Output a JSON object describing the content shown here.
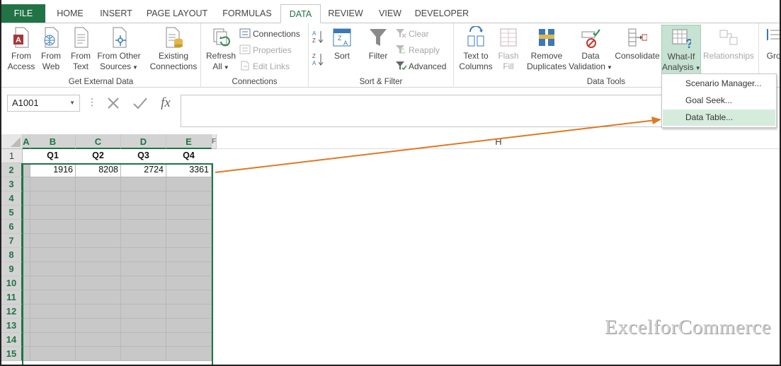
{
  "tabs": [
    "FILE",
    "HOME",
    "INSERT",
    "PAGE LAYOUT",
    "FORMULAS",
    "DATA",
    "REVIEW",
    "VIEW",
    "DEVELOPER"
  ],
  "active_tab": "DATA",
  "ribbon": {
    "get_external_data": {
      "label": "Get External Data",
      "from_access": [
        "From",
        "Access"
      ],
      "from_web": [
        "From",
        "Web"
      ],
      "from_text": [
        "From",
        "Text"
      ],
      "from_other": [
        "From Other",
        "Sources"
      ],
      "existing": [
        "Existing",
        "Connections"
      ]
    },
    "connections": {
      "label": "Connections",
      "refresh": [
        "Refresh",
        "All"
      ],
      "connections": "Connections",
      "properties": "Properties",
      "edit_links": "Edit Links"
    },
    "sort_filter": {
      "label": "Sort & Filter",
      "sort": "Sort",
      "filter": "Filter",
      "clear": "Clear",
      "reapply": "Reapply",
      "advanced": "Advanced"
    },
    "data_tools": {
      "label": "Data Tools",
      "text_to_columns": [
        "Text to",
        "Columns"
      ],
      "flash_fill": [
        "Flash",
        "Fill"
      ],
      "remove_duplicates": [
        "Remove",
        "Duplicates"
      ],
      "data_validation": [
        "Data",
        "Validation"
      ],
      "consolidate": "Consolidate",
      "what_if": [
        "What-If",
        "Analysis"
      ],
      "relationships": "Relationships"
    },
    "outline": {
      "group": "Grou"
    }
  },
  "whatif_menu": [
    "Scenario Manager...",
    "Goal Seek...",
    "Data Table..."
  ],
  "formula_bar": {
    "name_box": "A1001",
    "fx": "fx",
    "value": ""
  },
  "columns": [
    "A",
    "B",
    "C",
    "D",
    "E",
    "F",
    "H"
  ],
  "rows": [
    "1",
    "2",
    "3",
    "4",
    "5",
    "6",
    "7",
    "8",
    "9",
    "10",
    "11",
    "12",
    "13",
    "14",
    "15"
  ],
  "table": {
    "headers": [
      "Q1",
      "Q2",
      "Q3",
      "Q4"
    ],
    "values": [
      "1916",
      "8208",
      "2724",
      "3361"
    ]
  },
  "watermark": "ExcelforCommerce",
  "colors": {
    "excel_green": "#217346",
    "arrow": "#e07820",
    "selection_fill": "#c8c8c8"
  }
}
